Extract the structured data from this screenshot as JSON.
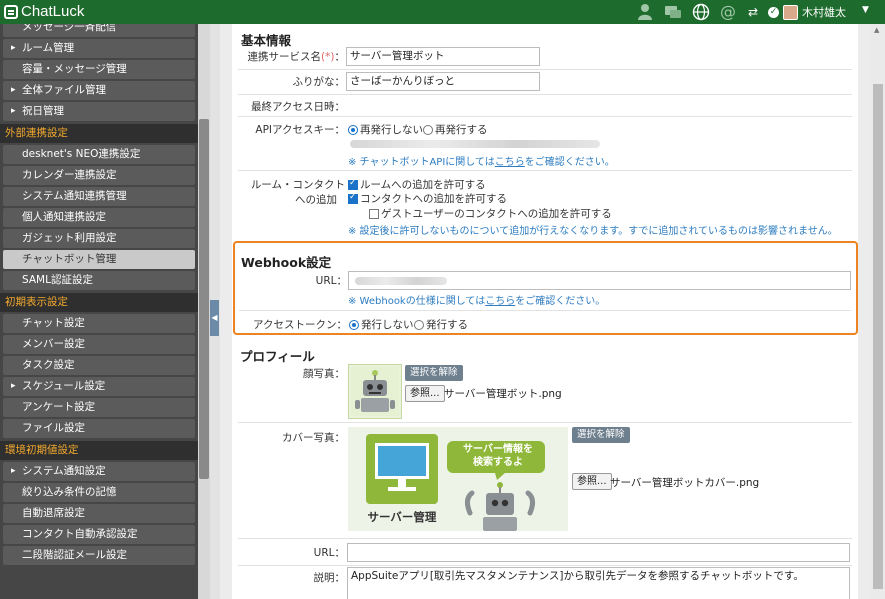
{
  "header": {
    "app_name": "ChatLuck",
    "user_name": "木村雄太",
    "icons": [
      "person-icon",
      "chat-icon",
      "globe-icon",
      "at-icon",
      "swap-icon"
    ]
  },
  "sidebar": {
    "items_top": [
      {
        "label": "メッセージ一斉配信",
        "arrow": false
      },
      {
        "label": "ルーム管理",
        "arrow": true
      },
      {
        "label": "容量・メッセージ管理",
        "arrow": false
      },
      {
        "label": "全体ファイル管理",
        "arrow": true
      },
      {
        "label": "祝日管理",
        "arrow": true
      }
    ],
    "section_external": "外部連携設定",
    "items_external": [
      {
        "label": "desknet's NEO連携設定",
        "arrow": false
      },
      {
        "label": "カレンダー連携設定",
        "arrow": false
      },
      {
        "label": "システム通知連携管理",
        "arrow": false
      },
      {
        "label": "個人通知連携設定",
        "arrow": false
      },
      {
        "label": "ガジェット利用設定",
        "arrow": false
      },
      {
        "label": "チャットボット管理",
        "arrow": false,
        "active": true
      },
      {
        "label": "SAML認証設定",
        "arrow": false
      }
    ],
    "section_initial": "初期表示設定",
    "items_initial": [
      {
        "label": "チャット設定",
        "arrow": false
      },
      {
        "label": "メンバー設定",
        "arrow": false
      },
      {
        "label": "タスク設定",
        "arrow": false
      },
      {
        "label": "スケジュール設定",
        "arrow": true
      },
      {
        "label": "アンケート設定",
        "arrow": false
      },
      {
        "label": "ファイル設定",
        "arrow": false
      }
    ],
    "section_env": "環境初期値設定",
    "items_env": [
      {
        "label": "システム通知設定",
        "arrow": true
      },
      {
        "label": "絞り込み条件の記憶",
        "arrow": false
      },
      {
        "label": "自動退席設定",
        "arrow": false
      },
      {
        "label": "コンタクト自動承認設定",
        "arrow": false
      },
      {
        "label": "二段階認証メール設定",
        "arrow": false
      }
    ]
  },
  "basic": {
    "title": "基本情報",
    "service_name_label": "連携サービス名",
    "required_mark": "(*)",
    "colon": "：",
    "service_name_value": "サーバー管理ボット",
    "furigana_label": "ふりがな",
    "furigana_value": "さーばーかんりぼっと",
    "last_access_label": "最終アクセス日時",
    "api_key_label": "APIアクセスキー",
    "api_reissue_no": "再発行しない",
    "api_reissue_yes": "再発行する",
    "api_note_prefix": "※ チャットボットAPIに関しては",
    "api_note_link": "こちら",
    "api_note_suffix": "をご確認ください。",
    "room_contact_label_1": "ルーム・コンタクト",
    "room_contact_label_2": "への追加",
    "allow_room": "ルームへの追加を許可する",
    "allow_contact": "コンタクトへの追加を許可する",
    "allow_guest": "ゲストユーザーのコンタクトへの追加を許可する",
    "room_note": "※ 設定後に許可しないものについて追加が行えなくなります。すでに追加されているものは影響されません。"
  },
  "webhook": {
    "title": "Webhook設定",
    "url_label": "URL",
    "url_note_prefix": "※ Webhookの仕様に関しては",
    "url_note_link": "こちら",
    "url_note_suffix": "をご確認ください。",
    "token_label": "アクセストークン",
    "token_no": "発行しない",
    "token_yes": "発行する"
  },
  "profile": {
    "title": "プロフィール",
    "photo_label": "顔写真",
    "clear_button": "選択を解除",
    "browse_button": "参照...",
    "photo_file": "サーバー管理ボット.png",
    "cover_label": "カバー写真",
    "cover_file": "サーバー管理ボットカバー.png",
    "cover_caption": "サーバー管理",
    "cover_bubble_1": "サーバー情報を",
    "cover_bubble_2": "検索するよ",
    "url_label": "URL",
    "desc_label": "説明",
    "desc_value": "AppSuiteアプリ[取引先マスタメンテナンス]から取引先データを参照するチャットボットです。"
  }
}
